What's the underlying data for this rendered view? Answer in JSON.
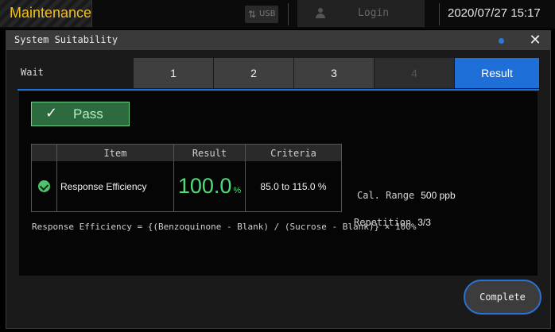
{
  "topbar": {
    "mode": "Maintenance",
    "usb_label": "USB",
    "login_label": "Login",
    "datetime": "2020/07/27 15:17"
  },
  "dialog": {
    "title": "System Suitability",
    "close_glyph": "✕"
  },
  "steps": {
    "wait_label": "Wait",
    "tabs": [
      {
        "label": "1",
        "state": "normal"
      },
      {
        "label": "2",
        "state": "normal"
      },
      {
        "label": "3",
        "state": "normal"
      },
      {
        "label": "4",
        "state": "disabled"
      },
      {
        "label": "Result",
        "state": "active"
      }
    ]
  },
  "status": {
    "pass_label": "Pass",
    "check_glyph": "✓"
  },
  "table": {
    "headers": [
      "Item",
      "Result",
      "Criteria"
    ],
    "rows": [
      {
        "status": "ok",
        "item": "Response Efficiency",
        "result_value": "100.0",
        "result_unit": "%",
        "criteria": "85.0 to 115.0 %"
      }
    ]
  },
  "info": {
    "cal_range_label": "Cal. Range",
    "cal_range_value": "500 ppb",
    "repetition_label": "Repetition",
    "repetition_value": "3/3"
  },
  "formula": "Response Efficiency = {(Benzoquinone - Blank) / (Sucrose - Blank)} × 100%",
  "complete_label": "Complete",
  "colors": {
    "accent_blue": "#1f6fd8",
    "pass_green": "#4fdc7a",
    "mode_yellow": "#f0c020"
  }
}
